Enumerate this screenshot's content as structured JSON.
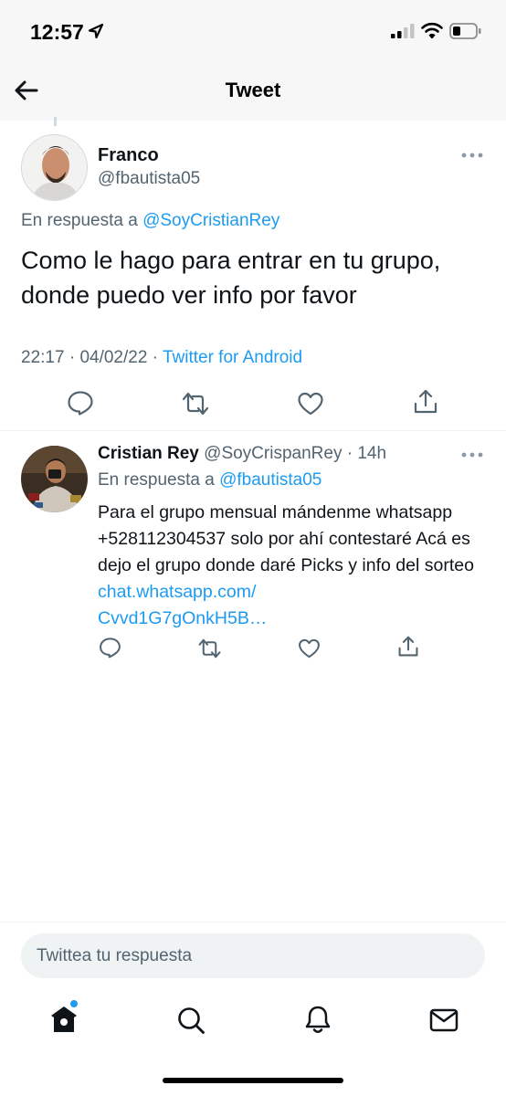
{
  "status_bar": {
    "time": "12:57"
  },
  "header": {
    "title": "Tweet"
  },
  "main_tweet": {
    "author_name": "Franco",
    "author_handle": "@fbautista05",
    "reply_prefix": "En respuesta a ",
    "reply_mention": "@SoyCristianRey",
    "text": "Como le hago para entrar en tu grupo, donde puedo ver info por favor",
    "time": "22:17",
    "date": "04/02/22",
    "source": "Twitter for Android",
    "separator": " · "
  },
  "reply_tweet": {
    "author_name": "Cristian Rey",
    "author_handle": "@SoyCrispanRey",
    "age": "14h",
    "separator": " · ",
    "reply_prefix": "En respuesta a ",
    "reply_mention": "@fbautista05",
    "text": "Para el grupo mensual mándenme whatsapp +528112304537 solo por ahí contestaré Acá es dejo el grupo donde daré Picks y info del sorteo ",
    "link_text": "chat.whatsapp.com/\nCvvd1G7gOnkH5B…"
  },
  "compose": {
    "placeholder": "Twittea tu respuesta"
  },
  "tab_bar": {
    "items": [
      "home-icon",
      "search-icon",
      "notifications-icon",
      "messages-icon"
    ]
  },
  "colors": {
    "accent": "#1d9bf0",
    "secondary_text": "#536471",
    "primary_text": "#0f1419"
  }
}
